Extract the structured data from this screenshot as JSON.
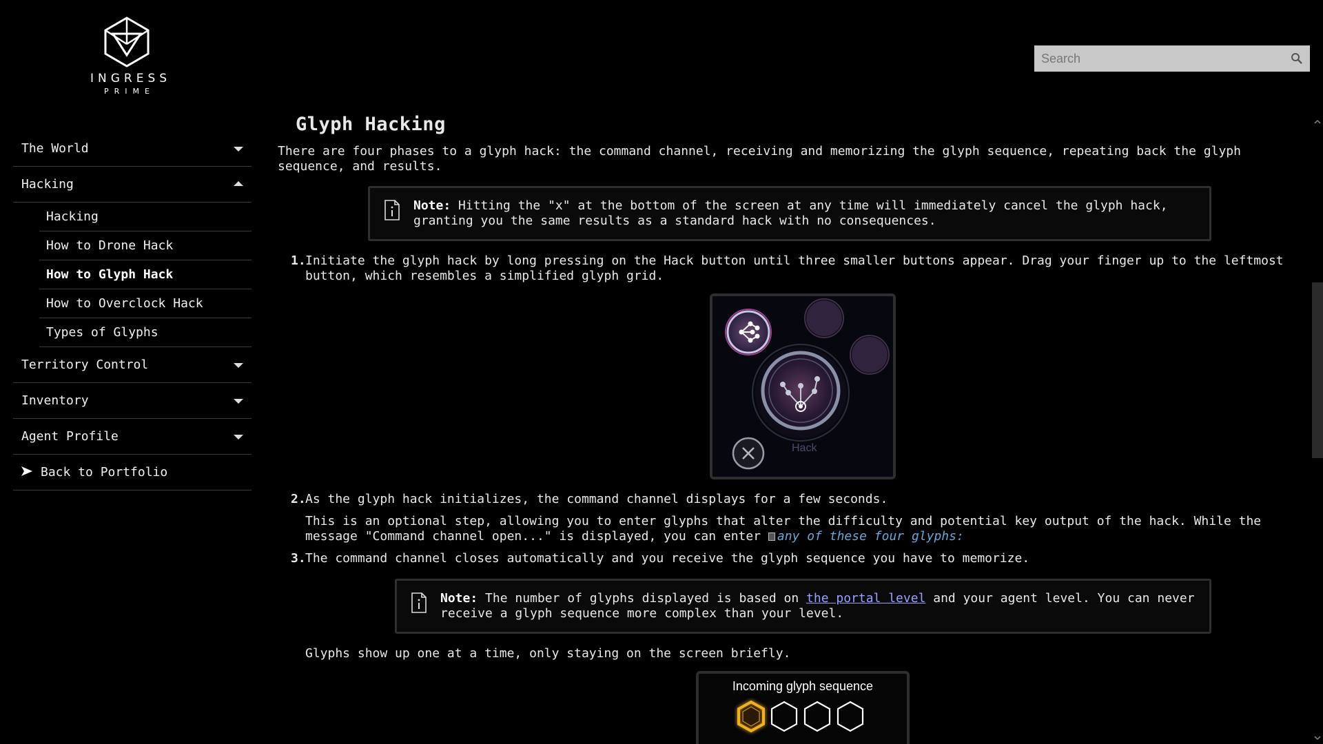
{
  "logo": {
    "name": "INGRESS",
    "sub": "PRIME"
  },
  "search": {
    "placeholder": "Search"
  },
  "sidebar": {
    "items": [
      {
        "label": "The World",
        "state": "collapsed"
      },
      {
        "label": "Hacking",
        "state": "expanded",
        "children": [
          "Hacking",
          "How to Drone Hack",
          "How to Glyph Hack",
          "How to Overclock Hack",
          "Types of Glyphs"
        ],
        "active_child": "How to Glyph Hack"
      },
      {
        "label": "Territory Control",
        "state": "collapsed"
      },
      {
        "label": "Inventory",
        "state": "collapsed"
      },
      {
        "label": "Agent Profile",
        "state": "collapsed"
      }
    ],
    "back_label": "Back to Portfolio"
  },
  "page": {
    "title": "Glyph Hacking",
    "intro": "There are four phases to a glyph hack: the command channel, receiving and memorizing the glyph sequence, repeating back the glyph sequence, and results.",
    "note1": {
      "label": "Note:",
      "text": " Hitting the \"x\" at the bottom of the screen at any time will immediately cancel the glyph hack, granting you the same results as a standard hack with no consequences."
    },
    "steps": [
      {
        "num": "1.",
        "text": "Initiate the glyph hack by long pressing on the Hack button until three smaller buttons appear. Drag your finger up to the leftmost button, which resembles a simplified glyph grid."
      },
      {
        "num": "2.",
        "text": "As the glyph hack initializes, the command channel displays for a few seconds.",
        "sub_text": "This is an optional step, allowing you to enter glyphs that alter the difficulty and potential key output of the hack. While the message \"Command channel open...\" is displayed, you can enter ",
        "sub_link": "any of these four glyphs:"
      },
      {
        "num": "3.",
        "text": "The command channel closes automatically and you receive the glyph sequence you have to memorize."
      }
    ],
    "note2": {
      "label": "Note:",
      "pre": " The number of glyphs displayed is based on ",
      "link": "the portal level",
      "post": " and your agent level. You can never receive a glyph sequence more complex than your level."
    },
    "glyphs_line": "Glyphs show up one at a time, only staying on the screen briefly.",
    "hack_image": {
      "button_label": "Hack"
    },
    "sequence_image": {
      "title": "Incoming glyph sequence",
      "hex_count": 4,
      "active_index": 0
    }
  },
  "colors": {
    "background": "#000000",
    "text": "#e8e8e8",
    "link": "#9aa0ff",
    "glyph_link": "#66a8d8",
    "active_hex": "#f0b020"
  }
}
